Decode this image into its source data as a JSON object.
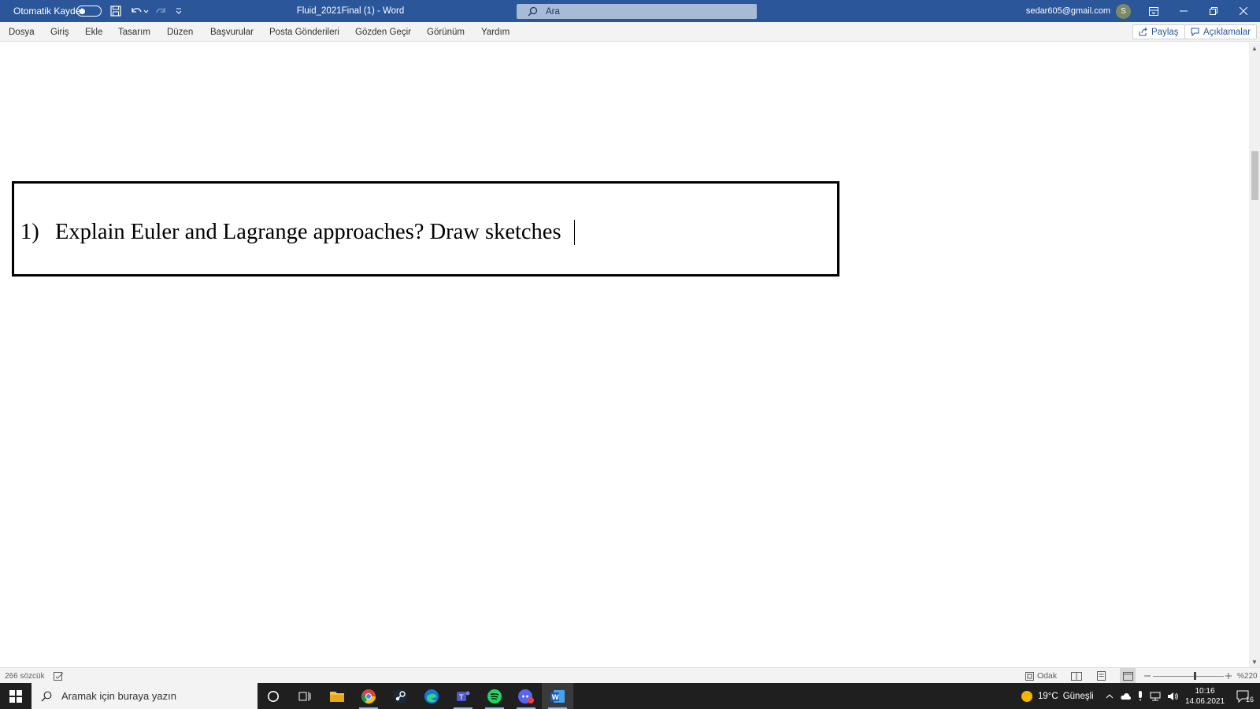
{
  "titlebar": {
    "autosave_label": "Otomatik Kaydet",
    "document_title": "Fluid_2021Final (1)  -  Word",
    "search_placeholder": "Ara",
    "account_email": "sedar605@gmail.com",
    "avatar_initial": "S"
  },
  "menu": {
    "tabs": [
      "Dosya",
      "Giriş",
      "Ekle",
      "Tasarım",
      "Düzen",
      "Başvurular",
      "Posta Gönderileri",
      "Gözden Geçir",
      "Görünüm",
      "Yardım"
    ],
    "share_label": "Paylaş",
    "comments_label": "Açıklamalar"
  },
  "document": {
    "question_number": "1)",
    "question_text": "Explain Euler and Lagrange approaches? Draw sketches"
  },
  "statusbar": {
    "word_count": "266 sözcük",
    "focus_label": "Odak",
    "zoom_level": "%220"
  },
  "taskbar": {
    "search_placeholder": "Aramak için buraya yazın",
    "apps": [
      "cortana-icon",
      "task-view-icon",
      "file-explorer-icon",
      "chrome-icon",
      "steam-icon",
      "edge-icon",
      "teams-icon",
      "spotify-icon",
      "discord-icon",
      "word-icon"
    ],
    "weather_temp": "19°C",
    "weather_text": "Güneşli",
    "time": "10:16",
    "date": "14.06.2021",
    "notification_count": "16"
  },
  "colors": {
    "word_blue": "#2b579a",
    "taskbar_bg": "#1f1f1f"
  }
}
